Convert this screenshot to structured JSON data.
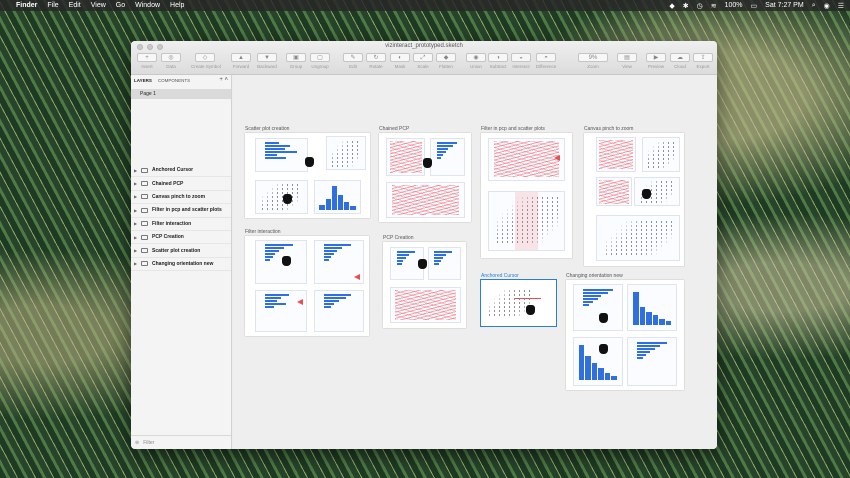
{
  "menubar": {
    "apple": "",
    "items": [
      "Finder",
      "File",
      "Edit",
      "View",
      "Go",
      "Window",
      "Help"
    ],
    "battery": "100%",
    "clock": "Sat 7:27 PM"
  },
  "window": {
    "title": "vizinteract_prototyped.sketch",
    "toolbar": [
      {
        "label": "Insert",
        "icon": "+"
      },
      {
        "label": "Data",
        "icon": "◎"
      },
      {
        "label": "Create Symbol",
        "icon": "◇"
      },
      {
        "label": "Forward",
        "icon": "▲"
      },
      {
        "label": "Backward",
        "icon": "▼"
      },
      {
        "label": "Group",
        "icon": "▣"
      },
      {
        "label": "Ungroup",
        "icon": "▢"
      },
      {
        "label": "Edit",
        "icon": "✎"
      },
      {
        "label": "Rotate",
        "icon": "↻"
      },
      {
        "label": "Mask",
        "icon": "◐"
      },
      {
        "label": "Scale",
        "icon": "⤢"
      },
      {
        "label": "Flatten",
        "icon": "◆"
      },
      {
        "label": "Union",
        "icon": "◉"
      },
      {
        "label": "Subtract",
        "icon": "◑"
      },
      {
        "label": "Intersect",
        "icon": "◒"
      },
      {
        "label": "Difference",
        "icon": "◓"
      },
      {
        "label": "Zoom",
        "icon": "9%"
      },
      {
        "label": "View",
        "icon": "▤"
      },
      {
        "label": "Preview",
        "icon": "▶"
      },
      {
        "label": "Cloud",
        "icon": "☁"
      },
      {
        "label": "Export",
        "icon": "⇪"
      }
    ]
  },
  "sidebar": {
    "tabs": [
      "LAYERS",
      "COMPONENTS"
    ],
    "page": "Page 1",
    "layers": [
      "Anchored Cursor",
      "Chained PCP",
      "Canvas pinch to zoom",
      "Filter in pcp and scatter plots",
      "Filter interaction",
      "PCP Creation",
      "Scatter plot creation",
      "Changing orientation new"
    ],
    "filter_placeholder": "Filter"
  },
  "artboards": {
    "scatter": "Scatter plot creation",
    "chained": "Chained PCP",
    "filter_pcp": "Filter in pcp and scatter plots",
    "pinch": "Canvas pinch to zoom",
    "filter_interaction": "Filter interaction",
    "pcp_creation": "PCP Creation",
    "anchored": "Anchored Cursor",
    "orientation": "Changing orientation new"
  },
  "colors": {
    "accent": "#2f6fe0",
    "pcp": "#e85a64",
    "selection": "#2a7fd4"
  }
}
